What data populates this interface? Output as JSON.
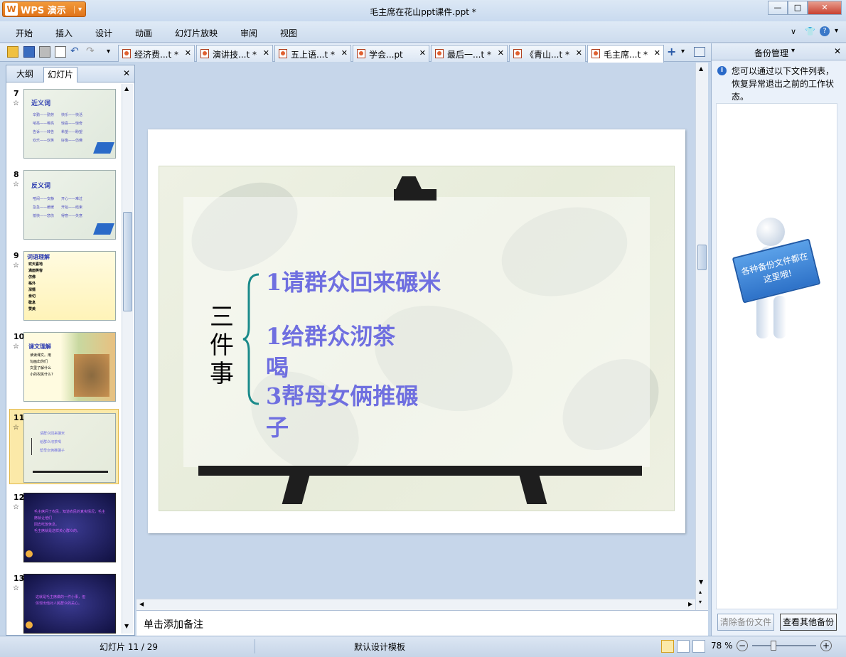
{
  "app": {
    "logo_label": "WPS 演示",
    "window_title": "毛主席在花山ppt课件.ppt *",
    "minimize": "—",
    "maximize": "□",
    "close": "✕"
  },
  "menu": {
    "items": [
      "开始",
      "插入",
      "设计",
      "动画",
      "幻灯片放映",
      "审阅",
      "视图"
    ]
  },
  "tabs": [
    {
      "label": "经济费...t *",
      "close": "✕"
    },
    {
      "label": "演讲技...t *",
      "close": "✕"
    },
    {
      "label": "五上语...t *",
      "close": "✕"
    },
    {
      "label": "学会...pt",
      "close": "✕"
    },
    {
      "label": "最后一...t *",
      "close": "✕"
    },
    {
      "label": "《青山...t *",
      "close": "✕"
    },
    {
      "label": "毛主席...t *",
      "close": "✕"
    }
  ],
  "add_tab": "+",
  "left_panel": {
    "tab_outline": "大纲",
    "tab_slides": "幻灯片",
    "close": "✕",
    "slides": [
      {
        "num": "7",
        "title": "近义词",
        "lines": [
          "辛勤——勤劳　　快乐——快活",
          "响亮——嘹亮　　惊喜——惊奇",
          "告诉——转告　　希望——盼望",
          "欢乐——欢笑　　好像——仿佛"
        ]
      },
      {
        "num": "8",
        "title": "反义词",
        "lines": [
          "喧闹——安静　　开心——难过",
          "急急——缓缓　　开始——结束",
          "愉快——悲伤　　得意——失意"
        ]
      },
      {
        "num": "9",
        "title": "词语理解",
        "lines": [
          "欢天喜地",
          "满面笑容",
          "仿佛",
          "格外",
          "深情",
          "亲切",
          "歇息",
          "赞美"
        ]
      },
      {
        "num": "10",
        "title": "课文理解",
        "lines": [
          "读读课文。用",
          "勾画出你们",
          "文里了解什么",
          "小的农民什么?"
        ]
      },
      {
        "num": "11",
        "title": "",
        "lines": [
          "请群众回来碾米",
          "给群众沏茶喝",
          "帮母女俩推碾子"
        ]
      },
      {
        "num": "12",
        "title": "",
        "lines": [
          "毛主席问了农民，知道农民的真实情况，毛主席就让他们",
          "回去吃饭休息。",
          "毛主席就是这样关心群众的。"
        ]
      },
      {
        "num": "13",
        "title": "",
        "lines": [
          "这就是毛主席做的一件小事，但",
          "体现出他对人民群众的关心。"
        ]
      }
    ]
  },
  "slide": {
    "side_title": "三件事",
    "lines": [
      "1请群众回来碾米",
      "1给群众沏茶",
      "喝",
      "3帮母女俩推碾",
      "子"
    ]
  },
  "notes_placeholder": "单击添加备注",
  "right_panel": {
    "title": "备份管理",
    "dropdown": "▾",
    "close": "✕",
    "info": "您可以通过以下文件列表，恢复异常退出之前的工作状态。",
    "sign_text": "各种备份文件都在这里哦!",
    "btn_clear": "清除备份文件",
    "btn_view": "查看其他备份"
  },
  "status": {
    "slide_info": "幻灯片 11 / 29",
    "template": "默认设计模板",
    "zoom": "78 %"
  },
  "colors": {
    "accent": "#6f6fe0",
    "brace": "#1a8a8a",
    "logo": "#e8821e"
  }
}
